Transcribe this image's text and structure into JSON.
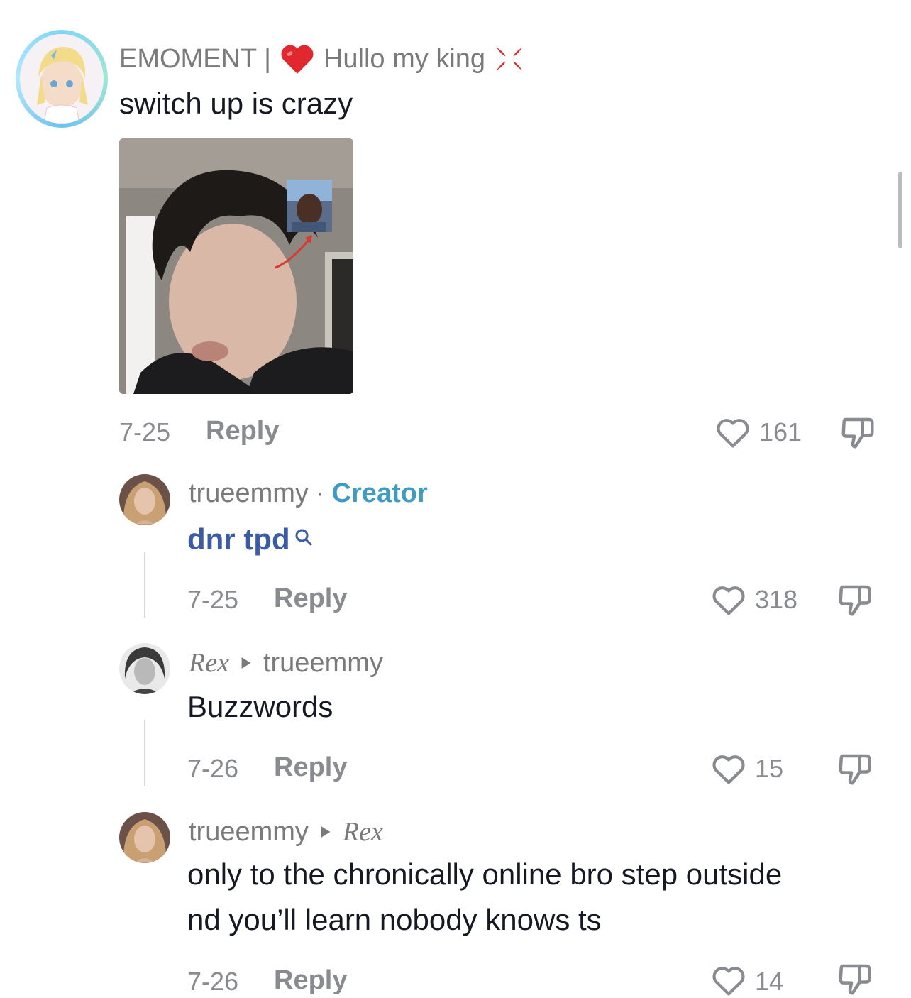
{
  "comments": [
    {
      "username": "EMOMENT |",
      "bio_suffix": "Hullo my king",
      "text": "switch up is crazy",
      "date": "7-25",
      "reply_label": "Reply",
      "likes": "161"
    },
    {
      "username": "trueemmy",
      "separator": "·",
      "badge": "Creator",
      "text": "dnr tpd",
      "date": "7-25",
      "reply_label": "Reply",
      "likes": "318"
    },
    {
      "username": "Rex",
      "reply_to": "trueemmy",
      "text": "Buzzwords",
      "date": "7-26",
      "reply_label": "Reply",
      "likes": "15"
    },
    {
      "username": "trueemmy",
      "reply_to": "Rex",
      "text_line1": "only to the chronically online bro step outside",
      "text_line2": "nd you’ll learn nobody knows ts",
      "date": "7-26",
      "reply_label": "Reply",
      "likes": "14"
    }
  ],
  "colors": {
    "creator_badge": "#3e9cc4",
    "search_link": "#3a5ba8",
    "meta_gray": "#8a8b91"
  }
}
